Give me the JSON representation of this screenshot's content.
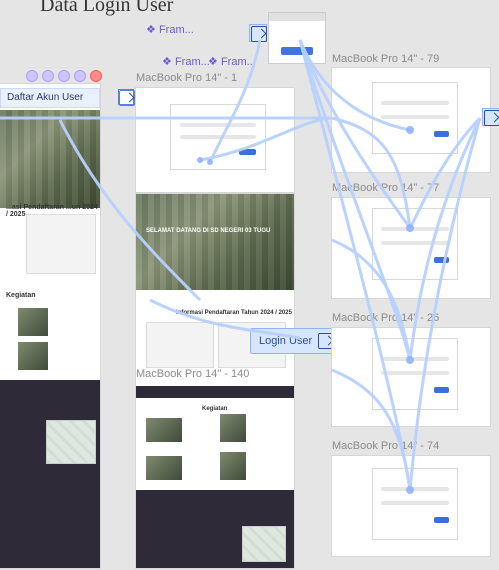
{
  "window": {
    "title": ""
  },
  "top_text": "Data Login User",
  "flow_labels": {
    "frame_1": "Fram...",
    "frame_2": "Fram...",
    "frame_3": "Fram...",
    "login_user": "Login User",
    "daftar_akun_user": "Daftar Akun User"
  },
  "frames": [
    {
      "id": "mbp-79",
      "label": "MacBook Pro 14\" - 79"
    },
    {
      "id": "mbp-77",
      "label": "MacBook Pro 14\" - 77"
    },
    {
      "id": "mbp-26",
      "label": "MacBook Pro 14\" - 26"
    },
    {
      "id": "mbp-74",
      "label": "MacBook Pro 14\" - 74"
    },
    {
      "id": "mbp-140",
      "label": "MacBook Pro 14\" - 140"
    },
    {
      "id": "mbp-1",
      "label": "MacBook Pro 14\" - 1"
    }
  ],
  "landing": {
    "hero_title": "SELAMAT DATANG DI SD NEGERI 03 TUGU",
    "section_info": "Informasi Pendaftaran Tahun 2024 / 2025",
    "section_kegiatan": "Kegiatan"
  },
  "left_landing": {
    "section_info": "...asi Pendaftaran ...un 2024 / 2025",
    "section_kegiatan": "Kegiatan"
  },
  "icons": {
    "flow": "flow-connection-icon",
    "diamond": "diamond-icon"
  },
  "colors": {
    "canvas": "#e5e5e5",
    "link": "#8fb4ff",
    "accent": "#6b5bd6",
    "dark": "#2e2a38",
    "primary": "#3b6fe0"
  }
}
